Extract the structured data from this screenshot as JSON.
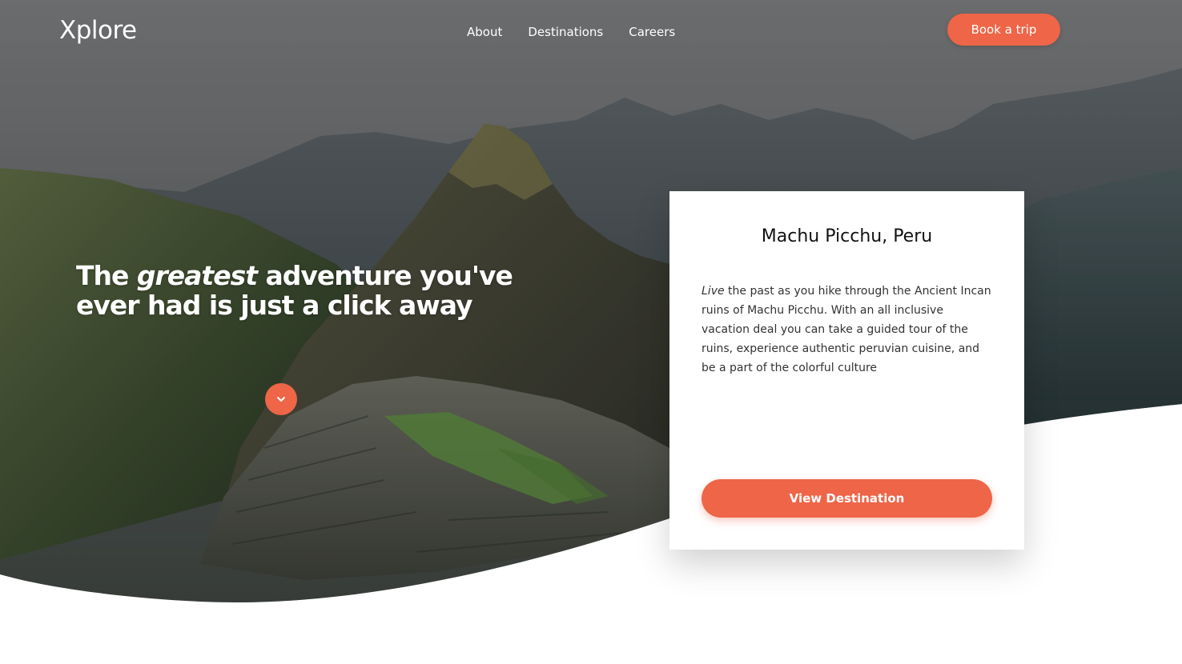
{
  "brand": {
    "logo": "Xplore"
  },
  "nav": {
    "items": [
      {
        "label": "About"
      },
      {
        "label": "Destinations"
      },
      {
        "label": "Careers"
      }
    ],
    "cta_label": "Book a trip"
  },
  "hero": {
    "headline_prefix": "The ",
    "headline_emphasis": "greatest",
    "headline_suffix": " adventure you've ever had is just a click away",
    "scroll_icon": "chevron-down-icon"
  },
  "card": {
    "title": "Machu Picchu, Peru",
    "body_emphasis": "Live",
    "body_text": " the past as you hike through the Ancient Incan ruins of Machu Picchu. With an all inclusive vacation deal you can take a guided tour of the ruins, experience authentic peruvian cuisine, and be a part of the colorful culture",
    "button_label": "View Destination"
  },
  "colors": {
    "accent": "#ee6548",
    "text_dark": "#111111",
    "white": "#ffffff"
  }
}
